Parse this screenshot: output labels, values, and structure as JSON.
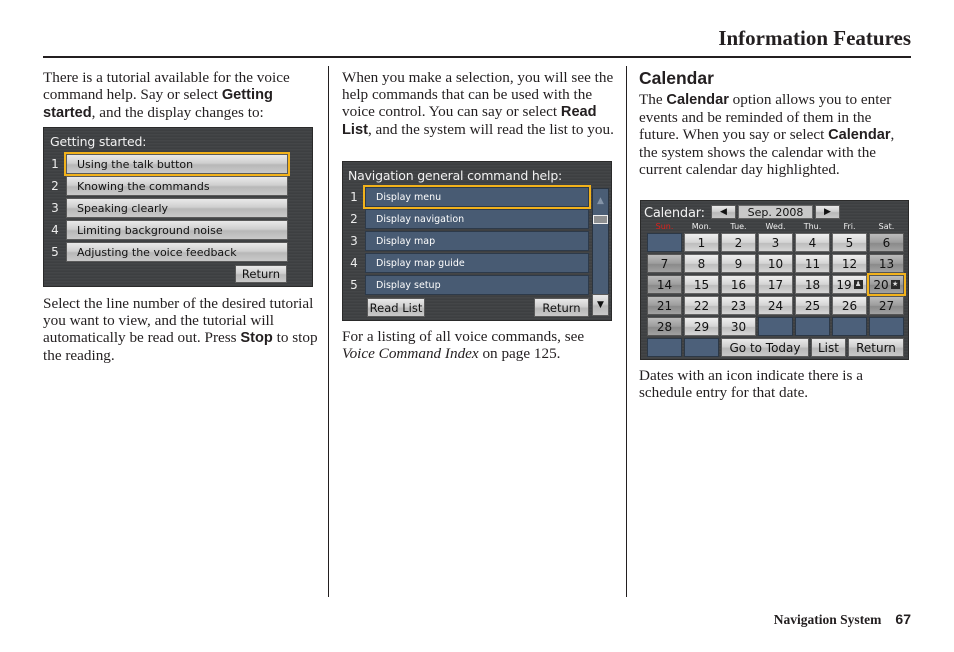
{
  "header": {
    "title": "Information Features"
  },
  "footer": {
    "book_title": "Navigation System",
    "page_number": "67"
  },
  "column1": {
    "intro": {
      "t1": "There is a tutorial available for the voice command help. Say or select ",
      "b1": "Getting started",
      "t2": ", and the display changes to:"
    },
    "outro": {
      "t1": "Select the line number of the desired tutorial you want to view, and the tutorial will automatically be read out. Press ",
      "b1": "Stop",
      "t2": " to stop the reading."
    },
    "screen": {
      "title": "Getting started:",
      "items": [
        {
          "num": "1",
          "label": "Using the talk button",
          "selected": true
        },
        {
          "num": "2",
          "label": "Knowing the commands",
          "selected": false
        },
        {
          "num": "3",
          "label": "Speaking clearly",
          "selected": false
        },
        {
          "num": "4",
          "label": "Limiting background noise",
          "selected": false
        },
        {
          "num": "5",
          "label": "Adjusting the voice feedback",
          "selected": false
        }
      ],
      "return_label": "Return"
    }
  },
  "column2": {
    "intro": {
      "t1": "When you make a selection, you will see the help commands that can be used with the voice control. You can say or select ",
      "b1": "Read List",
      "t2": ", and the system will read the list to you."
    },
    "outro": {
      "t1": "For a listing of all voice commands, see ",
      "i1": "Voice Command Index",
      "t2": " on page 125."
    },
    "screen": {
      "title": "Navigation general command help:",
      "items": [
        {
          "num": "1",
          "label": "Display menu",
          "selected": true
        },
        {
          "num": "2",
          "label": "Display navigation",
          "selected": false
        },
        {
          "num": "3",
          "label": "Display map",
          "selected": false
        },
        {
          "num": "4",
          "label": "Display map guide",
          "selected": false
        },
        {
          "num": "5",
          "label": "Display setup",
          "selected": false
        }
      ],
      "read_list_label": "Read List",
      "return_label": "Return",
      "scroll_up_icon": "▲",
      "scroll_down_icon": "▼"
    }
  },
  "column3": {
    "heading": "Calendar",
    "intro": {
      "t1": "The ",
      "b1": "Calendar",
      "t2": " option allows you to enter events and be reminded of them in the future. When you say or select ",
      "b2": "Calendar",
      "t3": ", the system shows the calendar with the current calendar day highlighted."
    },
    "outro": "Dates with an icon indicate there is a schedule entry for that date.",
    "screen": {
      "title": "Calendar:",
      "month_label": "Sep. 2008",
      "prev_icon": "◀",
      "next_icon": "▶",
      "weekdays": [
        "Sun.",
        "Mon.",
        "Tue.",
        "Wed.",
        "Thu.",
        "Fri.",
        "Sat."
      ],
      "first_weekday_index": 1,
      "days_in_month": 30,
      "selected_day": 20,
      "entries": [
        {
          "day": 19,
          "icon": "person-icon",
          "glyph": "♟"
        },
        {
          "day": 20,
          "icon": "star-icon",
          "glyph": "★"
        }
      ],
      "go_to_today_label": "Go to Today",
      "list_label": "List",
      "return_label": "Return"
    }
  },
  "colors": {
    "highlight": "#f2b21b",
    "sunday": "#e0201a",
    "row_blue": "#485b73"
  }
}
